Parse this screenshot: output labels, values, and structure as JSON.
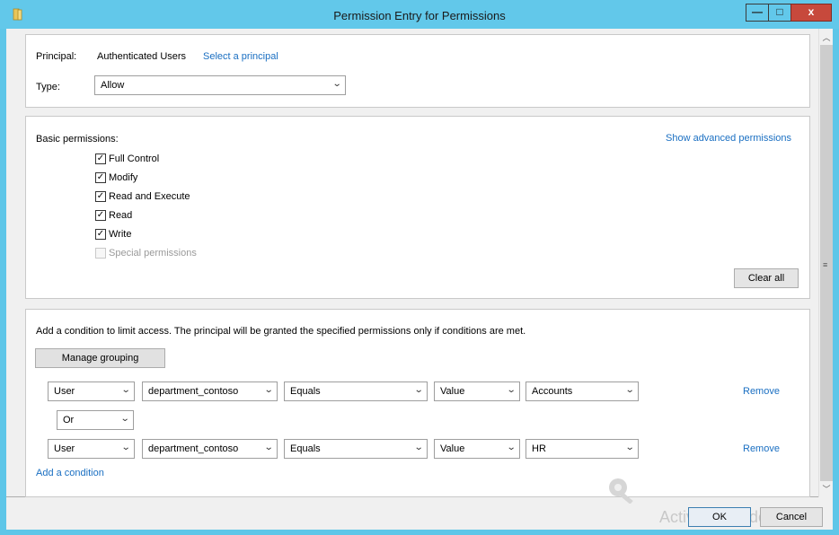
{
  "window": {
    "title": "Permission Entry for Permissions",
    "min_label": "—",
    "max_label": "□",
    "close_label": "x"
  },
  "principal": {
    "label": "Principal:",
    "value": "Authenticated Users",
    "select_link": "Select a principal",
    "type_label": "Type:",
    "type_value": "Allow"
  },
  "basic": {
    "label": "Basic permissions:",
    "show_advanced": "Show advanced permissions",
    "items": [
      {
        "label": "Full Control",
        "checked": true,
        "enabled": true
      },
      {
        "label": "Modify",
        "checked": true,
        "enabled": true
      },
      {
        "label": "Read and Execute",
        "checked": true,
        "enabled": true
      },
      {
        "label": "Read",
        "checked": true,
        "enabled": true
      },
      {
        "label": "Write",
        "checked": true,
        "enabled": true
      },
      {
        "label": "Special permissions",
        "checked": false,
        "enabled": false
      }
    ],
    "clear_all": "Clear all"
  },
  "conditions": {
    "description": "Add a condition to limit access. The principal will be granted the specified permissions only if conditions are met.",
    "manage_grouping": "Manage grouping",
    "rows": [
      {
        "subject": "User",
        "attribute": "department_contoso",
        "operator": "Equals",
        "value_type": "Value",
        "value": "Accounts",
        "remove": "Remove"
      },
      {
        "subject": "User",
        "attribute": "department_contoso",
        "operator": "Equals",
        "value_type": "Value",
        "value": "HR",
        "remove": "Remove"
      }
    ],
    "connector": "Or",
    "add_condition": "Add a condition"
  },
  "footer": {
    "ok": "OK",
    "cancel": "Cancel",
    "watermark": "Activate Windows"
  },
  "colors": {
    "titlebar": "#62c8ea",
    "link": "#1a6fc2",
    "close": "#c7493c"
  }
}
